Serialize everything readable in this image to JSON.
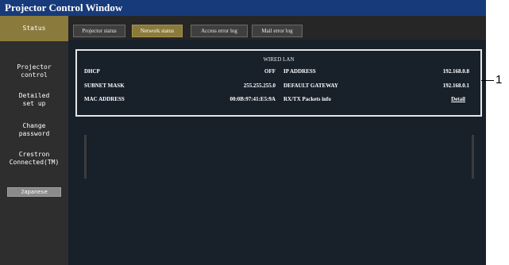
{
  "window": {
    "title": "Projector Control Window"
  },
  "sidebar": {
    "items": [
      {
        "label": "Status",
        "active": true
      },
      {
        "label": "Projector\ncontrol",
        "active": false
      },
      {
        "label": "Detailed\nset up",
        "active": false
      },
      {
        "label": "Change\npassword",
        "active": false
      },
      {
        "label": "Crestron\nConnected(TM)",
        "active": false
      }
    ],
    "language_button": "Japanese"
  },
  "tabs": [
    {
      "label": "Projector status",
      "active": false
    },
    {
      "label": "Network status",
      "active": true
    },
    {
      "label": "Access error log",
      "active": false
    },
    {
      "label": "Mail error log",
      "active": false
    }
  ],
  "wired_lan": {
    "title": "WIRED LAN",
    "rows": [
      {
        "left_label": "DHCP",
        "left_value": "OFF",
        "right_label": "IP ADDRESS",
        "right_value": "192.168.0.8"
      },
      {
        "left_label": "SUBNET MASK",
        "left_value": "255.255.255.0",
        "right_label": "DEFAULT GATEWAY",
        "right_value": "192.168.0.1"
      },
      {
        "left_label": "MAC ADDRESS",
        "left_value": "00:0B:97:41:E5:9A",
        "right_label": "RX/TX Packets info",
        "right_value": "Detail"
      }
    ]
  },
  "callout": {
    "number": "1"
  },
  "colors": {
    "title_bar": "#173a7a",
    "active": "#8a7a3c",
    "sidebar": "#2e2e2e",
    "content": "#18202a"
  }
}
